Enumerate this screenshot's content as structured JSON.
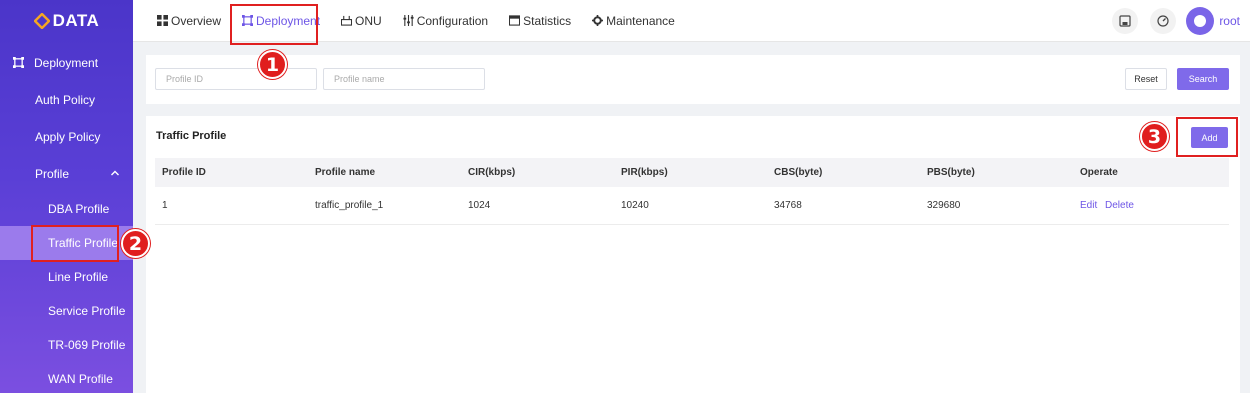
{
  "brand": {
    "logo_text": "DATA"
  },
  "sidebar": {
    "top": {
      "label": "Deployment",
      "icon": "deployment-icon"
    },
    "items": [
      {
        "label": "Auth Policy"
      },
      {
        "label": "Apply Policy"
      },
      {
        "label": "Profile",
        "expanded": true
      }
    ],
    "profile_children": [
      {
        "label": "DBA Profile"
      },
      {
        "label": "Traffic Profile",
        "active": true
      },
      {
        "label": "Line Profile"
      },
      {
        "label": "Service Profile"
      },
      {
        "label": "TR-069 Profile"
      },
      {
        "label": "WAN Profile"
      }
    ]
  },
  "header": {
    "tabs": [
      {
        "label": "Overview",
        "icon": "grid-icon"
      },
      {
        "label": "Deployment",
        "icon": "deployment-icon",
        "active": true
      },
      {
        "label": "ONU",
        "icon": "onu-icon"
      },
      {
        "label": "Configuration",
        "icon": "sliders-icon"
      },
      {
        "label": "Statistics",
        "icon": "window-icon"
      },
      {
        "label": "Maintenance",
        "icon": "gear-icon"
      }
    ],
    "user": {
      "name": "root"
    }
  },
  "search": {
    "profile_id_placeholder": "Profile ID",
    "profile_name_placeholder": "Profile name",
    "reset_label": "Reset",
    "search_label": "Search"
  },
  "table_panel": {
    "title": "Traffic Profile",
    "add_label": "Add",
    "columns": [
      "Profile ID",
      "Profile name",
      "CIR(kbps)",
      "PIR(kbps)",
      "CBS(byte)",
      "PBS(byte)",
      "Operate"
    ],
    "rows": [
      {
        "cells": [
          "1",
          "traffic_profile_1",
          "1024",
          "10240",
          "34768",
          "329680"
        ],
        "actions": [
          "Edit",
          "Delete"
        ]
      }
    ]
  },
  "annotations": {
    "step1": "1",
    "step2": "2",
    "step3": "3"
  },
  "colors": {
    "accent": "#6d55e6",
    "sidebar": "#5a3fd6",
    "annotation": "#e02020"
  }
}
